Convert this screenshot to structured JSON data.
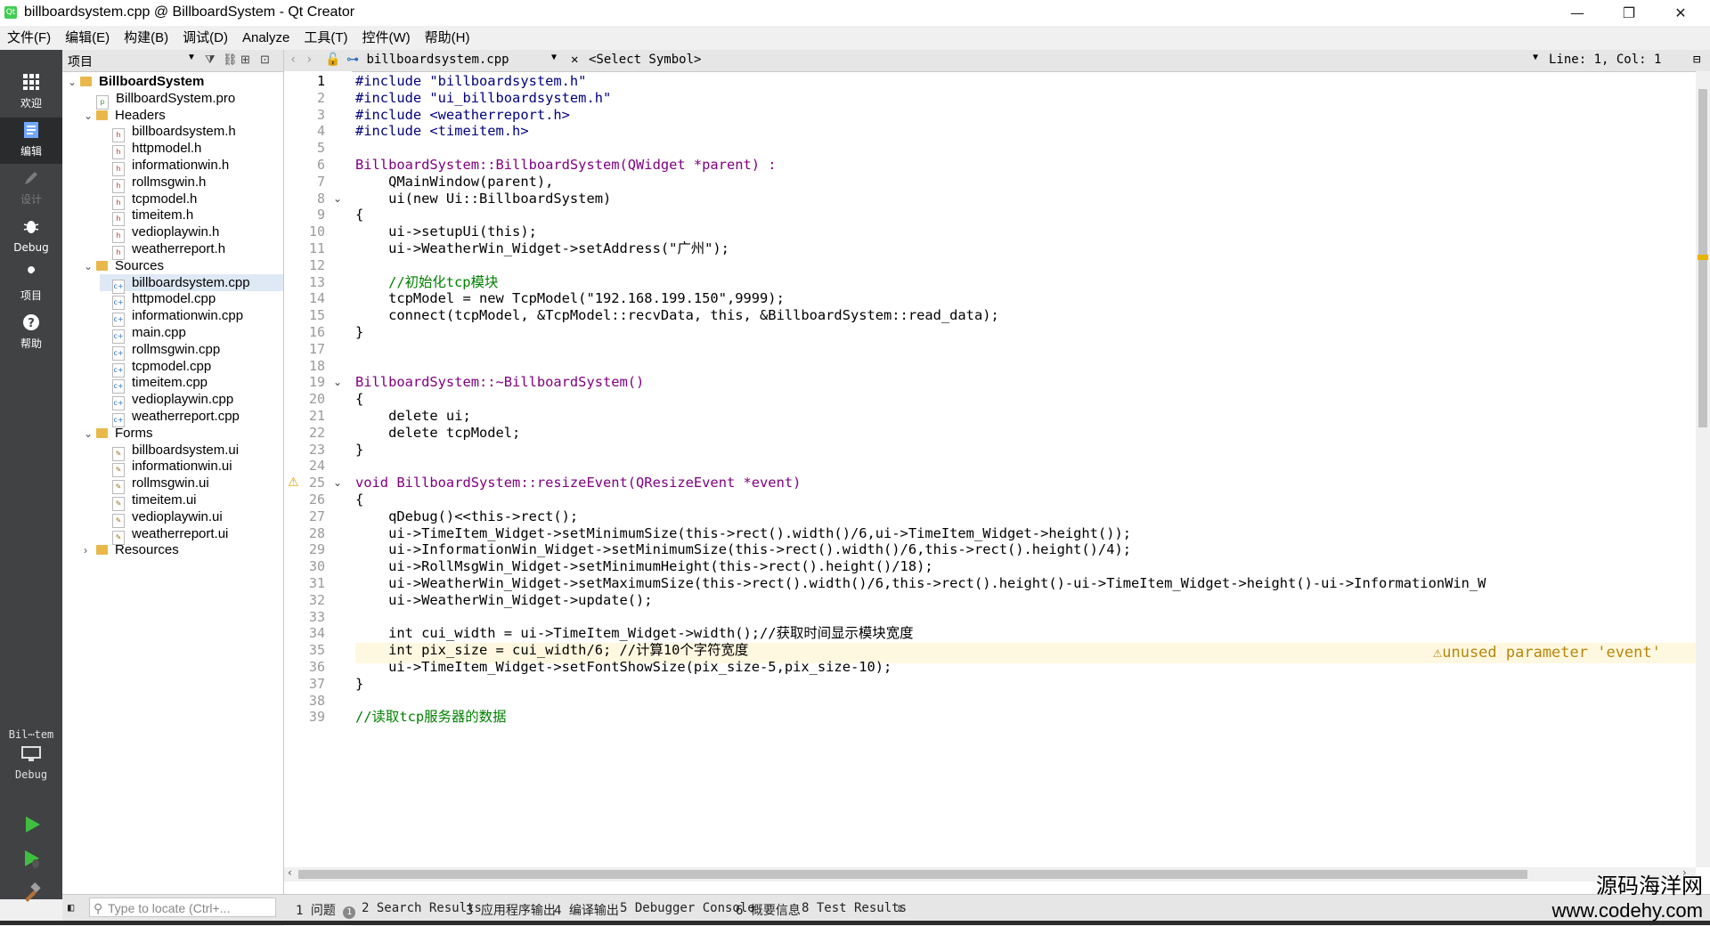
{
  "window": {
    "title": "billboardsystem.cpp @ BillboardSystem - Qt Creator",
    "minimize": "—",
    "restore": "❐",
    "close": "✕"
  },
  "menu": [
    "文件(F)",
    "编辑(E)",
    "构建(B)",
    "调试(D)",
    "Analyze",
    "工具(T)",
    "控件(W)",
    "帮助(H)"
  ],
  "modes": [
    {
      "label": "欢迎",
      "icon": "grid-icon"
    },
    {
      "label": "编辑",
      "icon": "document-icon"
    },
    {
      "label": "设计",
      "icon": "pencil-icon"
    },
    {
      "label": "Debug",
      "icon": "bug-icon"
    },
    {
      "label": "项目",
      "icon": "wrench-icon"
    },
    {
      "label": "帮助",
      "icon": "help-icon"
    }
  ],
  "kit": {
    "name": "Bil⋯tem",
    "mode": "Debug"
  },
  "project_pane": {
    "title": "项目",
    "tree": [
      {
        "label": "BillboardSystem",
        "depth": 0,
        "kind": "project",
        "expanded": true
      },
      {
        "label": "BillboardSystem.pro",
        "depth": 1,
        "kind": "pro"
      },
      {
        "label": "Headers",
        "depth": 1,
        "kind": "folder",
        "expanded": true
      },
      {
        "label": "billboardsystem.h",
        "depth": 2,
        "kind": "h"
      },
      {
        "label": "httpmodel.h",
        "depth": 2,
        "kind": "h"
      },
      {
        "label": "informationwin.h",
        "depth": 2,
        "kind": "h"
      },
      {
        "label": "rollmsgwin.h",
        "depth": 2,
        "kind": "h"
      },
      {
        "label": "tcpmodel.h",
        "depth": 2,
        "kind": "h"
      },
      {
        "label": "timeitem.h",
        "depth": 2,
        "kind": "h"
      },
      {
        "label": "vedioplaywin.h",
        "depth": 2,
        "kind": "h"
      },
      {
        "label": "weatherreport.h",
        "depth": 2,
        "kind": "h"
      },
      {
        "label": "Sources",
        "depth": 1,
        "kind": "folder",
        "expanded": true
      },
      {
        "label": "billboardsystem.cpp",
        "depth": 2,
        "kind": "cpp",
        "selected": true
      },
      {
        "label": "httpmodel.cpp",
        "depth": 2,
        "kind": "cpp"
      },
      {
        "label": "informationwin.cpp",
        "depth": 2,
        "kind": "cpp"
      },
      {
        "label": "main.cpp",
        "depth": 2,
        "kind": "cpp"
      },
      {
        "label": "rollmsgwin.cpp",
        "depth": 2,
        "kind": "cpp"
      },
      {
        "label": "tcpmodel.cpp",
        "depth": 2,
        "kind": "cpp"
      },
      {
        "label": "timeitem.cpp",
        "depth": 2,
        "kind": "cpp"
      },
      {
        "label": "vedioplaywin.cpp",
        "depth": 2,
        "kind": "cpp"
      },
      {
        "label": "weatherreport.cpp",
        "depth": 2,
        "kind": "cpp"
      },
      {
        "label": "Forms",
        "depth": 1,
        "kind": "folder",
        "expanded": true
      },
      {
        "label": "billboardsystem.ui",
        "depth": 2,
        "kind": "ui"
      },
      {
        "label": "informationwin.ui",
        "depth": 2,
        "kind": "ui"
      },
      {
        "label": "rollmsgwin.ui",
        "depth": 2,
        "kind": "ui"
      },
      {
        "label": "timeitem.ui",
        "depth": 2,
        "kind": "ui"
      },
      {
        "label": "vedioplaywin.ui",
        "depth": 2,
        "kind": "ui"
      },
      {
        "label": "weatherreport.ui",
        "depth": 2,
        "kind": "ui"
      },
      {
        "label": "Resources",
        "depth": 1,
        "kind": "folder",
        "expanded": false
      }
    ]
  },
  "editor": {
    "file": "billboardsystem.cpp",
    "symbol": "<Select Symbol>",
    "position": "Line: 1, Col: 1",
    "warning": "⚠unused parameter 'event'",
    "lines": [
      "#include \"billboardsystem.h\"",
      "#include \"ui_billboardsystem.h\"",
      "#include <weatherreport.h>",
      "#include <timeitem.h>",
      "",
      "BillboardSystem::BillboardSystem(QWidget *parent) :",
      "    QMainWindow(parent),",
      "    ui(new Ui::BillboardSystem)",
      "{",
      "    ui->setupUi(this);",
      "    ui->WeatherWin_Widget->setAddress(\"广州\");",
      "",
      "    //初始化tcp模块",
      "    tcpModel = new TcpModel(\"192.168.199.150\",9999);",
      "    connect(tcpModel, &TcpModel::recvData, this, &BillboardSystem::read_data);",
      "}",
      "",
      "",
      "BillboardSystem::~BillboardSystem()",
      "{",
      "    delete ui;",
      "    delete tcpModel;",
      "}",
      "",
      "void BillboardSystem::resizeEvent(QResizeEvent *event)",
      "{",
      "    qDebug()<<this->rect();",
      "    ui->TimeItem_Widget->setMinimumSize(this->rect().width()/6,ui->TimeItem_Widget->height());",
      "    ui->InformationWin_Widget->setMinimumSize(this->rect().width()/6,this->rect().height()/4);",
      "    ui->RollMsgWin_Widget->setMinimumHeight(this->rect().height()/18);",
      "    ui->WeatherWin_Widget->setMaximumSize(this->rect().width()/6,this->rect().height()-ui->TimeItem_Widget->height()-ui->InformationWin_W",
      "    ui->WeatherWin_Widget->update();",
      "",
      "    int cui_width = ui->TimeItem_Widget->width();//获取时间显示模块宽度",
      "    int pix_size = cui_width/6; //计算10个字符宽度",
      "    ui->TimeItem_Widget->setFontShowSize(pix_size-5,pix_size-10);",
      "}",
      "",
      "//读取tcp服务器的数据"
    ]
  },
  "statusbar": {
    "locate_placeholder": "Type to locate (Ctrl+...",
    "tabs": [
      "1 问题",
      "2 Search Results",
      "3 应用程序输出",
      "4 编译输出",
      "5 Debugger Console",
      "6 概要信息",
      "8 Test Results"
    ],
    "problem_count": "1"
  },
  "watermark": {
    "line1": "源码海洋网",
    "line2": "www.codehy.com"
  }
}
